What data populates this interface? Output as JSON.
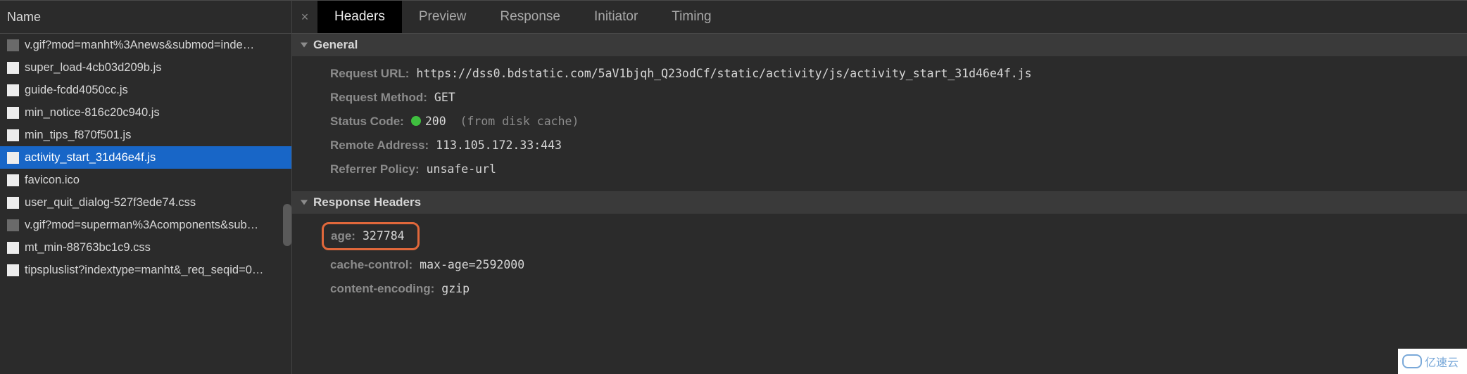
{
  "left": {
    "header": "Name",
    "files": [
      {
        "name": "v.gif?mod=manht%3Anews&submod=inde…",
        "iconClass": "gray"
      },
      {
        "name": "super_load-4cb03d209b.js",
        "iconClass": ""
      },
      {
        "name": "guide-fcdd4050cc.js",
        "iconClass": ""
      },
      {
        "name": "min_notice-816c20c940.js",
        "iconClass": ""
      },
      {
        "name": "min_tips_f870f501.js",
        "iconClass": ""
      },
      {
        "name": "activity_start_31d46e4f.js",
        "iconClass": "",
        "selected": true
      },
      {
        "name": "favicon.ico",
        "iconClass": ""
      },
      {
        "name": "user_quit_dialog-527f3ede74.css",
        "iconClass": ""
      },
      {
        "name": "v.gif?mod=superman%3Acomponents&sub…",
        "iconClass": "gray"
      },
      {
        "name": "mt_min-88763bc1c9.css",
        "iconClass": ""
      },
      {
        "name": "tipspluslist?indextype=manht&_req_seqid=0…",
        "iconClass": ""
      }
    ]
  },
  "tabs": {
    "close": "×",
    "items": [
      "Headers",
      "Preview",
      "Response",
      "Initiator",
      "Timing"
    ],
    "activeIndex": 0
  },
  "general": {
    "title": "General",
    "request_url_key": "Request URL:",
    "request_url_val": "https://dss0.bdstatic.com/5aV1bjqh_Q23odCf/static/activity/js/activity_start_31d46e4f.js",
    "request_method_key": "Request Method:",
    "request_method_val": "GET",
    "status_code_key": "Status Code:",
    "status_code_val": "200",
    "status_code_extra": "(from disk cache)",
    "remote_addr_key": "Remote Address:",
    "remote_addr_val": "113.105.172.33:443",
    "referrer_key": "Referrer Policy:",
    "referrer_val": "unsafe-url"
  },
  "response_headers": {
    "title": "Response Headers",
    "age_key": "age:",
    "age_val": "327784",
    "cache_key": "cache-control:",
    "cache_val": "max-age=2592000",
    "enc_key": "content-encoding:",
    "enc_val": "gzip"
  },
  "watermark": "亿速云"
}
